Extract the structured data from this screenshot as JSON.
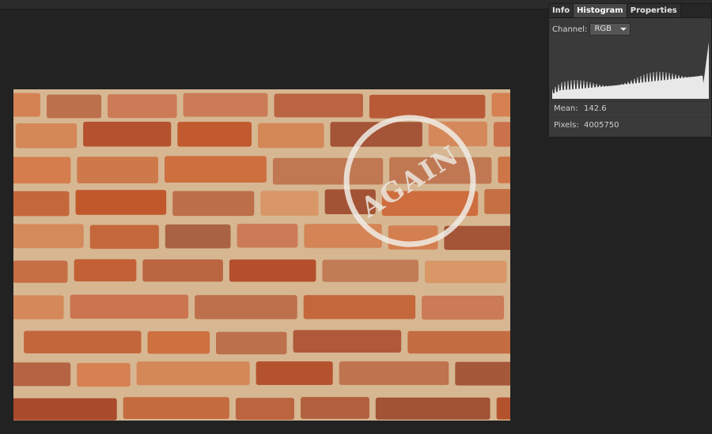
{
  "panel": {
    "tabs": [
      {
        "label": "Info",
        "active": false
      },
      {
        "label": "Histogram",
        "active": true
      },
      {
        "label": "Properties",
        "active": false
      }
    ],
    "channel_label": "Channel:",
    "channel_value": "RGB",
    "stats": {
      "mean_label": "Mean:",
      "mean_value": "142.6",
      "pixels_label": "Pixels:",
      "pixels_value": "4005750"
    }
  },
  "image": {
    "stamp_text": "AGAIN"
  },
  "colors": {
    "background": "#222222",
    "panel": "#3a3a3a",
    "histogram": "#e8e8e8",
    "brick": "#c0582c",
    "mortar": "#d9b995"
  }
}
